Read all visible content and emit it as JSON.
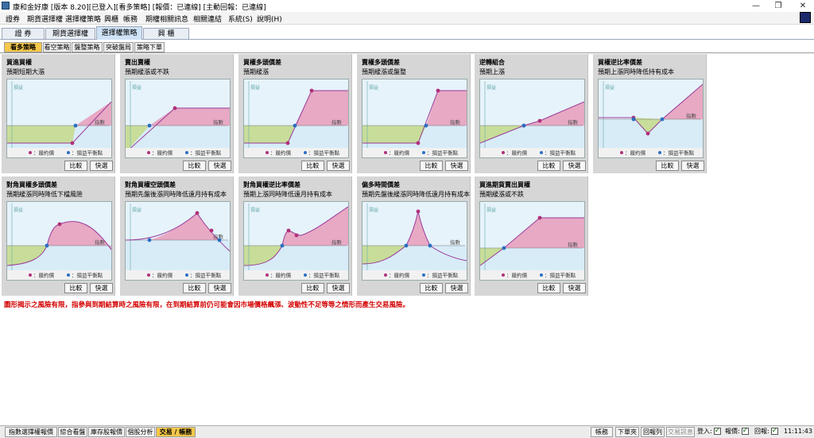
{
  "window": {
    "title": "康和金好康 [版本 8.20][已登入][看多策略] [報價：已連線] [主動回報：已連線]",
    "controls": {
      "minimize": "—",
      "maximize": "❐",
      "close": "✕"
    }
  },
  "menu": [
    "證券",
    "期貨選擇權",
    "選擇權策略",
    "興櫃",
    "帳務",
    "期權相關訊息",
    "相關連結",
    "系統(S)",
    "說明(H)"
  ],
  "main_tabs": [
    {
      "label": "證 券",
      "active": false
    },
    {
      "label": "期貨選擇權",
      "active": false
    },
    {
      "label": "選擇權策略",
      "active": true
    },
    {
      "label": "興 櫃",
      "active": false
    }
  ],
  "sub_tabs": [
    {
      "label": "看多策略",
      "active": true
    },
    {
      "label": "看空策略",
      "active": false
    },
    {
      "label": "盤整策略",
      "active": false
    },
    {
      "label": "突破盤局",
      "active": false
    },
    {
      "label": "策略下單",
      "active": false
    }
  ],
  "plot_labels": {
    "yaxis": "損益",
    "xaxis": "指數",
    "legend_strike": "：履約價",
    "legend_breakeven": "：損益平衡點"
  },
  "buttons": {
    "compare": "比較",
    "quick_order": "快選"
  },
  "colors": {
    "profit": "#e8608e",
    "loss": "#b9d24a",
    "strike": "#b0307a",
    "breakeven": "#2a6fc2",
    "line": "#9a3a9a"
  },
  "strategies": [
    {
      "title": "買進買權",
      "subtitle": "預期短期大漲"
    },
    {
      "title": "賣出賣權",
      "subtitle": "預期緩漲或不跌"
    },
    {
      "title": "買權多頭價差",
      "subtitle": "預期緩漲"
    },
    {
      "title": "賣權多頭價差",
      "subtitle": "預期緩漲或盤整"
    },
    {
      "title": "逆轉組合",
      "subtitle": "預期上漲"
    },
    {
      "title": "買權逆比率價差",
      "subtitle": "預期上漲同時降低持有成本"
    },
    {
      "title": "對角買權多頭價差",
      "subtitle": "預期緩漲同時降低下檔風險"
    },
    {
      "title": "對角買權空頭價差",
      "subtitle": "預期先盤後漲同時降低遠月持有成本"
    },
    {
      "title": "對角買權逆比率價差",
      "subtitle": "預期上漲同時降低遠月持有成本"
    },
    {
      "title": "偏多時間價差",
      "subtitle": "預期先盤後緩漲同時降低遠月持有成本"
    },
    {
      "title": "買進期貨賣出買權",
      "subtitle": "預期緩漲或不跌"
    }
  ],
  "warning": "圖形揭示之風險有限，指參與到期結算時之風險有限，在到期結算前仍可能會因市場價格飆漲、波動性不足等等之情形而產生交易風險。",
  "bottom_tabs": [
    {
      "label": "指數選擇權報價",
      "active": false
    },
    {
      "label": "綜合看盤",
      "active": false
    },
    {
      "label": "庫存股報價",
      "active": false
    },
    {
      "label": "個股分析",
      "active": false
    },
    {
      "label": "交易 / 帳務",
      "active": true
    }
  ],
  "status": {
    "account": "帳務",
    "order": "下單夾",
    "report": "回報列",
    "info": "交易訊息",
    "login": "登入:",
    "quote": "報價:",
    "reply": "回報:",
    "time": "11:11:43"
  }
}
